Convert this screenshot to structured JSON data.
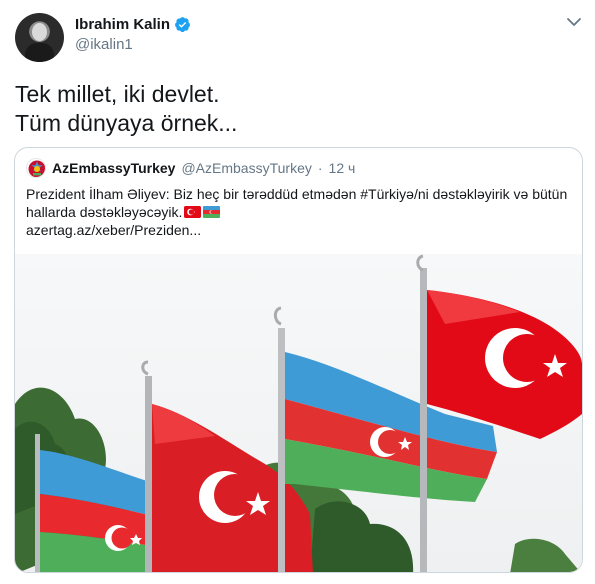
{
  "author": {
    "display_name": "Ibrahim Kalin",
    "handle": "@ikalin1",
    "verified": true
  },
  "tweet": {
    "lines": [
      "Tek millet, iki devlet.",
      "Tüm dünyaya örnek..."
    ]
  },
  "quoted": {
    "display_name": "AzEmbassyTurkey",
    "handle": "@AzEmbassyTurkey",
    "separator": "·",
    "time": "12 ч",
    "text": "Prezident İlham Əliyev: Biz heç bir tərəddüd etmədən #Türkiyə/ni dəstəkləyirik və bütün hallarda dəstəkləyəcəyik.",
    "link": "azertag.az/xeber/Preziden...",
    "emoji_icons": [
      "turkey-flag-icon",
      "azerbaijan-flag-icon"
    ]
  },
  "colors": {
    "verified": "#1da1f2",
    "turkey_red": "#e30a17",
    "az_blue": "#3f9bd6",
    "az_red": "#e8292e",
    "az_green": "#4fae59",
    "secondary_text": "#657786",
    "border": "#ccd6dd"
  },
  "icons": [
    "verified-badge-icon",
    "chevron-down-icon"
  ]
}
